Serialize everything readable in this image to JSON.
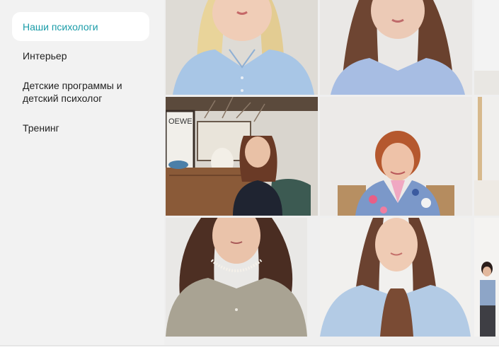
{
  "sidebar": {
    "items": [
      {
        "label": "Наши психологи",
        "active": true
      },
      {
        "label": "Интерьер",
        "active": false
      },
      {
        "label": "Детские программы и детский психолог",
        "active": false
      },
      {
        "label": "Тренинг",
        "active": false
      }
    ]
  },
  "gallery": {
    "sign_text": "OEWE"
  },
  "colors": {
    "accent": "#1a9ca8",
    "sidebar_bg": "#f2f2f2"
  }
}
